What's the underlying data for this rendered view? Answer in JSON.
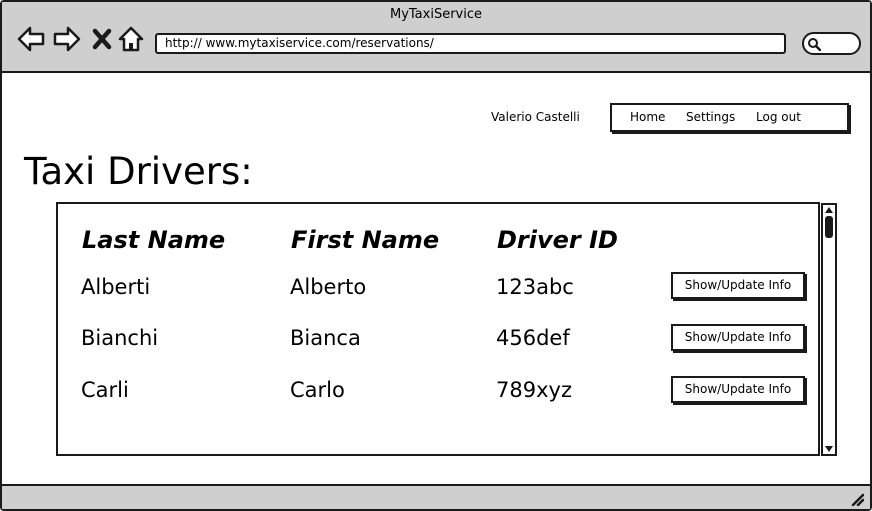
{
  "window": {
    "title": "MyTaxiService"
  },
  "browser": {
    "url": "http:// www.mytaxiservice.com/reservations/",
    "icons": [
      "back-icon",
      "forward-icon",
      "close-icon",
      "home-icon",
      "search-icon"
    ]
  },
  "header": {
    "user_name": "Valerio Castelli",
    "menu": [
      {
        "label": "Home"
      },
      {
        "label": "Settings"
      },
      {
        "label": "Log out"
      }
    ]
  },
  "page": {
    "title": "Taxi Drivers:"
  },
  "table": {
    "columns": [
      "Last Name",
      "First Name",
      "Driver ID"
    ],
    "rows": [
      {
        "last_name": "Alberti",
        "first_name": "Alberto",
        "driver_id": "123abc",
        "action": "Show/Update Info"
      },
      {
        "last_name": "Bianchi",
        "first_name": "Bianca",
        "driver_id": "456def",
        "action": "Show/Update Info"
      },
      {
        "last_name": "Carli",
        "first_name": "Carlo",
        "driver_id": "789xyz",
        "action": "Show/Update Info"
      }
    ]
  },
  "colors": {
    "chrome": "#cfcfcf",
    "border": "#1a1a1a",
    "background": "#ffffff"
  }
}
